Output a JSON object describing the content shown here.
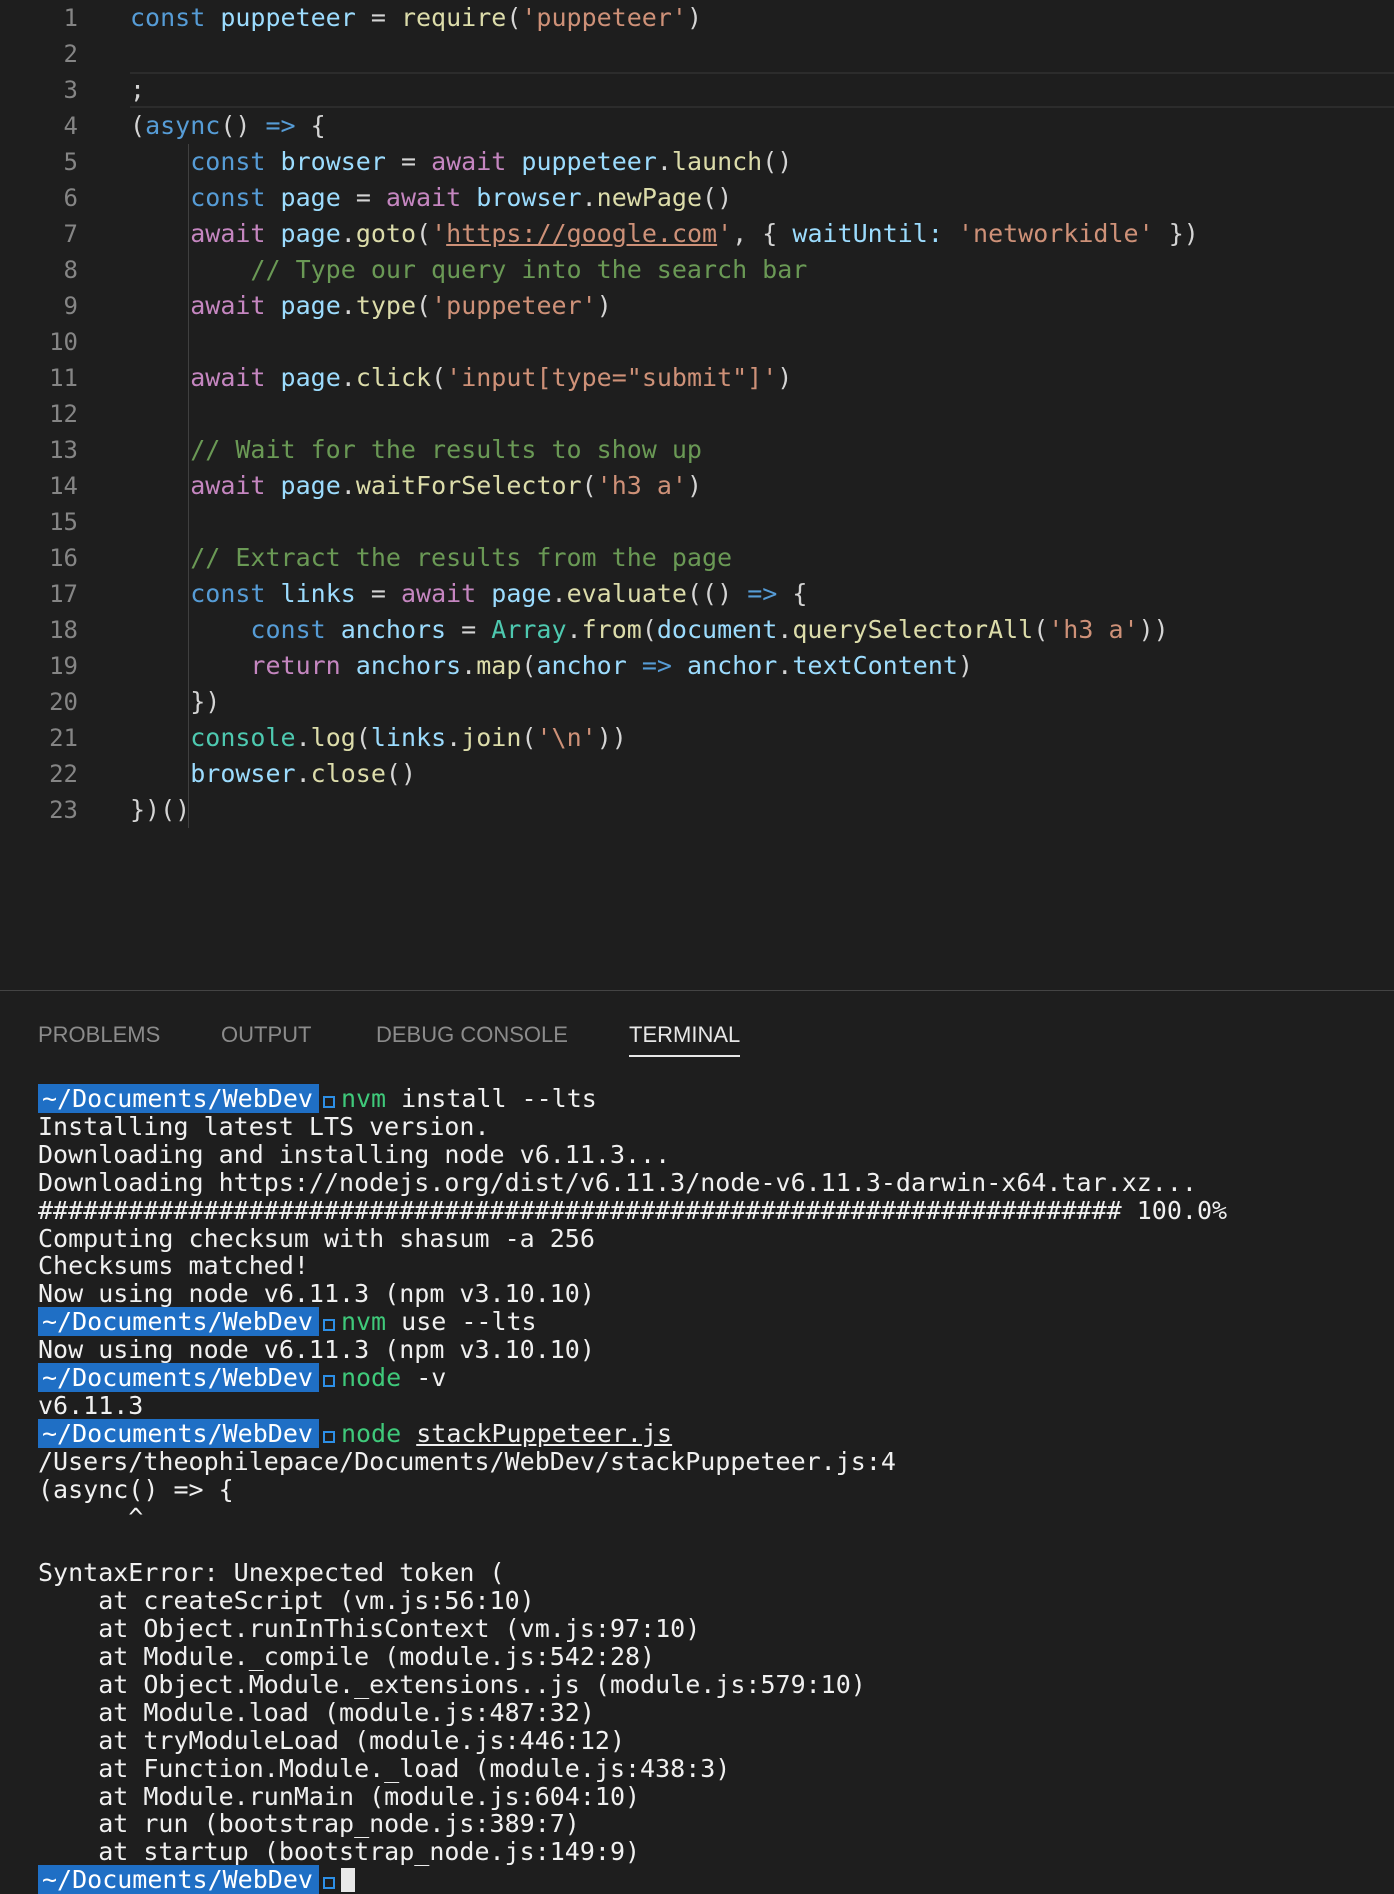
{
  "editor": {
    "line_numbers": [
      "1",
      "2",
      "3",
      "4",
      "5",
      "6",
      "7",
      "8",
      "9",
      "10",
      "11",
      "12",
      "13",
      "14",
      "15",
      "16",
      "17",
      "18",
      "19",
      "20",
      "21",
      "22",
      "23"
    ],
    "code": [
      [
        {
          "t": "const",
          "c": "kw"
        },
        {
          "t": " "
        },
        {
          "t": "puppeteer",
          "c": "var"
        },
        {
          "t": " = "
        },
        {
          "t": "require",
          "c": "fn"
        },
        {
          "t": "("
        },
        {
          "t": "'puppeteer'",
          "c": "str"
        },
        {
          "t": ")"
        }
      ],
      [],
      [
        {
          "t": ";"
        }
      ],
      [
        {
          "t": "("
        },
        {
          "t": "async",
          "c": "kw"
        },
        {
          "t": "() "
        },
        {
          "t": "=>",
          "c": "kw"
        },
        {
          "t": " {"
        }
      ],
      [
        {
          "t": "    "
        },
        {
          "t": "const",
          "c": "kw"
        },
        {
          "t": " "
        },
        {
          "t": "browser",
          "c": "var"
        },
        {
          "t": " = "
        },
        {
          "t": "await",
          "c": "ctl"
        },
        {
          "t": " "
        },
        {
          "t": "puppeteer",
          "c": "var"
        },
        {
          "t": "."
        },
        {
          "t": "launch",
          "c": "fn"
        },
        {
          "t": "()"
        }
      ],
      [
        {
          "t": "    "
        },
        {
          "t": "const",
          "c": "kw"
        },
        {
          "t": " "
        },
        {
          "t": "page",
          "c": "var"
        },
        {
          "t": " = "
        },
        {
          "t": "await",
          "c": "ctl"
        },
        {
          "t": " "
        },
        {
          "t": "browser",
          "c": "var"
        },
        {
          "t": "."
        },
        {
          "t": "newPage",
          "c": "fn"
        },
        {
          "t": "()"
        }
      ],
      [
        {
          "t": "    "
        },
        {
          "t": "await",
          "c": "ctl"
        },
        {
          "t": " "
        },
        {
          "t": "page",
          "c": "var"
        },
        {
          "t": "."
        },
        {
          "t": "goto",
          "c": "fn"
        },
        {
          "t": "("
        },
        {
          "t": "'",
          "c": "str"
        },
        {
          "t": "https://google.com",
          "c": "url"
        },
        {
          "t": "'",
          "c": "str"
        },
        {
          "t": ", { "
        },
        {
          "t": "waitUntil:",
          "c": "var"
        },
        {
          "t": " "
        },
        {
          "t": "'networkidle'",
          "c": "str"
        },
        {
          "t": " })"
        }
      ],
      [
        {
          "t": "        "
        },
        {
          "t": "// Type our query into the search bar",
          "c": "cm"
        }
      ],
      [
        {
          "t": "    "
        },
        {
          "t": "await",
          "c": "ctl"
        },
        {
          "t": " "
        },
        {
          "t": "page",
          "c": "var"
        },
        {
          "t": "."
        },
        {
          "t": "type",
          "c": "fn"
        },
        {
          "t": "("
        },
        {
          "t": "'puppeteer'",
          "c": "str"
        },
        {
          "t": ")"
        }
      ],
      [],
      [
        {
          "t": "    "
        },
        {
          "t": "await",
          "c": "ctl"
        },
        {
          "t": " "
        },
        {
          "t": "page",
          "c": "var"
        },
        {
          "t": "."
        },
        {
          "t": "click",
          "c": "fn"
        },
        {
          "t": "("
        },
        {
          "t": "'input[type=\"submit\"]'",
          "c": "str"
        },
        {
          "t": ")"
        }
      ],
      [],
      [
        {
          "t": "    "
        },
        {
          "t": "// Wait for the results to show up",
          "c": "cm"
        }
      ],
      [
        {
          "t": "    "
        },
        {
          "t": "await",
          "c": "ctl"
        },
        {
          "t": " "
        },
        {
          "t": "page",
          "c": "var"
        },
        {
          "t": "."
        },
        {
          "t": "waitForSelector",
          "c": "fn"
        },
        {
          "t": "("
        },
        {
          "t": "'h3 a'",
          "c": "str"
        },
        {
          "t": ")"
        }
      ],
      [],
      [
        {
          "t": "    "
        },
        {
          "t": "// Extract the results from the page",
          "c": "cm"
        }
      ],
      [
        {
          "t": "    "
        },
        {
          "t": "const",
          "c": "kw"
        },
        {
          "t": " "
        },
        {
          "t": "links",
          "c": "var"
        },
        {
          "t": " = "
        },
        {
          "t": "await",
          "c": "ctl"
        },
        {
          "t": " "
        },
        {
          "t": "page",
          "c": "var"
        },
        {
          "t": "."
        },
        {
          "t": "evaluate",
          "c": "fn"
        },
        {
          "t": "(() "
        },
        {
          "t": "=>",
          "c": "kw"
        },
        {
          "t": " {"
        }
      ],
      [
        {
          "t": "        "
        },
        {
          "t": "const",
          "c": "kw"
        },
        {
          "t": " "
        },
        {
          "t": "anchors",
          "c": "var"
        },
        {
          "t": " = "
        },
        {
          "t": "Array",
          "c": "cls"
        },
        {
          "t": "."
        },
        {
          "t": "from",
          "c": "fn"
        },
        {
          "t": "("
        },
        {
          "t": "document",
          "c": "var"
        },
        {
          "t": "."
        },
        {
          "t": "querySelectorAll",
          "c": "fn"
        },
        {
          "t": "("
        },
        {
          "t": "'h3 a'",
          "c": "str"
        },
        {
          "t": "))"
        }
      ],
      [
        {
          "t": "        "
        },
        {
          "t": "return",
          "c": "ctl"
        },
        {
          "t": " "
        },
        {
          "t": "anchors",
          "c": "var"
        },
        {
          "t": "."
        },
        {
          "t": "map",
          "c": "fn"
        },
        {
          "t": "("
        },
        {
          "t": "anchor",
          "c": "var"
        },
        {
          "t": " "
        },
        {
          "t": "=>",
          "c": "kw"
        },
        {
          "t": " "
        },
        {
          "t": "anchor",
          "c": "var"
        },
        {
          "t": "."
        },
        {
          "t": "textContent",
          "c": "var"
        },
        {
          "t": ")"
        }
      ],
      [
        {
          "t": "    })"
        }
      ],
      [
        {
          "t": "    "
        },
        {
          "t": "console",
          "c": "cls"
        },
        {
          "t": "."
        },
        {
          "t": "log",
          "c": "fn"
        },
        {
          "t": "("
        },
        {
          "t": "links",
          "c": "var"
        },
        {
          "t": "."
        },
        {
          "t": "join",
          "c": "fn"
        },
        {
          "t": "("
        },
        {
          "t": "'\\n'",
          "c": "str"
        },
        {
          "t": "))"
        }
      ],
      [
        {
          "t": "    "
        },
        {
          "t": "browser",
          "c": "var"
        },
        {
          "t": "."
        },
        {
          "t": "close",
          "c": "fn"
        },
        {
          "t": "()"
        }
      ],
      [
        {
          "t": "})()"
        }
      ]
    ]
  },
  "panel": {
    "tabs": [
      "PROBLEMS",
      "OUTPUT",
      "DEBUG CONSOLE",
      "TERMINAL"
    ],
    "active_tab": "TERMINAL"
  },
  "terminal": {
    "lines": [
      {
        "type": "prompt",
        "path": "~/Documents/WebDev",
        "cmd": "nvm",
        "args": " install --lts"
      },
      {
        "type": "out",
        "text": "Installing latest LTS version."
      },
      {
        "type": "out",
        "text": "Downloading and installing node v6.11.3..."
      },
      {
        "type": "out",
        "text": "Downloading https://nodejs.org/dist/v6.11.3/node-v6.11.3-darwin-x64.tar.xz..."
      },
      {
        "type": "out",
        "text": "######################################################################## 100.0%"
      },
      {
        "type": "out",
        "text": "Computing checksum with shasum -a 256"
      },
      {
        "type": "out",
        "text": "Checksums matched!"
      },
      {
        "type": "out",
        "text": "Now using node v6.11.3 (npm v3.10.10)"
      },
      {
        "type": "prompt",
        "path": "~/Documents/WebDev",
        "cmd": "nvm",
        "args": " use --lts"
      },
      {
        "type": "out",
        "text": "Now using node v6.11.3 (npm v3.10.10)"
      },
      {
        "type": "prompt",
        "path": "~/Documents/WebDev",
        "cmd": "node",
        "args": " -v"
      },
      {
        "type": "out",
        "text": "v6.11.3"
      },
      {
        "type": "prompt",
        "path": "~/Documents/WebDev",
        "cmd": "node",
        "args": " ",
        "file": "stackPuppeteer.js"
      },
      {
        "type": "out",
        "text": "/Users/theophilepace/Documents/WebDev/stackPuppeteer.js:4"
      },
      {
        "type": "out",
        "text": "(async() => {"
      },
      {
        "type": "out",
        "text": "      ^"
      },
      {
        "type": "out",
        "text": ""
      },
      {
        "type": "out",
        "text": "SyntaxError: Unexpected token ("
      },
      {
        "type": "out",
        "text": "    at createScript (vm.js:56:10)"
      },
      {
        "type": "out",
        "text": "    at Object.runInThisContext (vm.js:97:10)"
      },
      {
        "type": "out",
        "text": "    at Module._compile (module.js:542:28)"
      },
      {
        "type": "out",
        "text": "    at Object.Module._extensions..js (module.js:579:10)"
      },
      {
        "type": "out",
        "text": "    at Module.load (module.js:487:32)"
      },
      {
        "type": "out",
        "text": "    at tryModuleLoad (module.js:446:12)"
      },
      {
        "type": "out",
        "text": "    at Function.Module._load (module.js:438:3)"
      },
      {
        "type": "out",
        "text": "    at Module.runMain (module.js:604:10)"
      },
      {
        "type": "out",
        "text": "    at run (bootstrap_node.js:389:7)"
      },
      {
        "type": "out",
        "text": "    at startup (bootstrap_node.js:149:9)"
      },
      {
        "type": "prompt",
        "path": "~/Documents/WebDev",
        "cursor": true
      }
    ]
  },
  "colors": {
    "background": "#1e1e1e",
    "keyword": "#569cd6",
    "control": "#c586c0",
    "function": "#dcdcaa",
    "variable": "#9cdcfe",
    "string": "#ce9178",
    "comment": "#6a9955",
    "class": "#4ec9b0",
    "prompt_bg": "#1f6fc5",
    "command": "#3fc97a"
  }
}
